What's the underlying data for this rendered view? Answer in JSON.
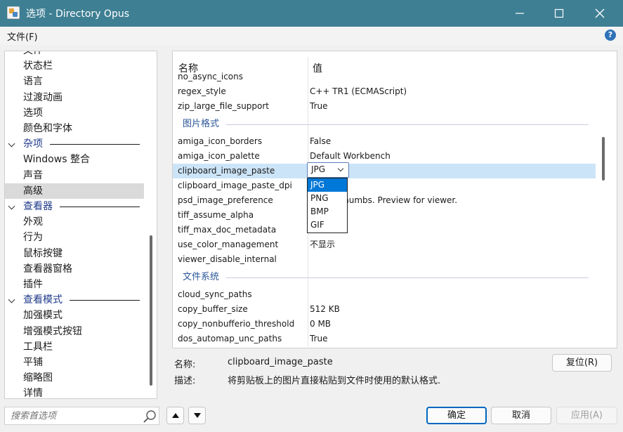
{
  "window": {
    "title": "选项 - Directory Opus"
  },
  "menu": {
    "file": "文件(F)",
    "help": "?"
  },
  "tree": {
    "items": [
      {
        "label": "文件",
        "group": false
      },
      {
        "label": "状态栏",
        "group": false
      },
      {
        "label": "语言",
        "group": false
      },
      {
        "label": "过渡动画",
        "group": false
      },
      {
        "label": "选项",
        "group": false
      },
      {
        "label": "颜色和字体",
        "group": false
      },
      {
        "label": "杂项",
        "group": true
      },
      {
        "label": "Windows 整合",
        "group": false
      },
      {
        "label": "声音",
        "group": false
      },
      {
        "label": "高级",
        "group": false,
        "selected": true
      },
      {
        "label": "查看器",
        "group": true
      },
      {
        "label": "外观",
        "group": false
      },
      {
        "label": "行为",
        "group": false
      },
      {
        "label": "鼠标按键",
        "group": false
      },
      {
        "label": "查看器窗格",
        "group": false
      },
      {
        "label": "插件",
        "group": false
      },
      {
        "label": "查看模式",
        "group": true
      },
      {
        "label": "加强模式",
        "group": false
      },
      {
        "label": "增强模式按钮",
        "group": false
      },
      {
        "label": "工具栏",
        "group": false
      },
      {
        "label": "平铺",
        "group": false
      },
      {
        "label": "缩略图",
        "group": false
      },
      {
        "label": "详情",
        "group": false
      }
    ]
  },
  "search": {
    "placeholder": "搜索首选项"
  },
  "grid": {
    "col_name": "名称",
    "col_value": "值",
    "rows": [
      {
        "type": "row",
        "name": "no_async_icons",
        "value": ""
      },
      {
        "type": "row",
        "name": "regex_style",
        "value": "C++ TR1 (ECMAScript)"
      },
      {
        "type": "row",
        "name": "zip_large_file_support",
        "value": "True"
      },
      {
        "type": "section",
        "label": "图片格式"
      },
      {
        "type": "row",
        "name": "amiga_icon_borders",
        "value": "False"
      },
      {
        "type": "row",
        "name": "amiga_icon_palette",
        "value": "Default Workbench"
      },
      {
        "type": "row",
        "name": "clipboard_image_paste",
        "value": "",
        "selected": true
      },
      {
        "type": "row",
        "name": "clipboard_image_paste_dpi",
        "value": ""
      },
      {
        "type": "row",
        "name": "psd_image_preference",
        "value": "mb for thumbs. Preview for viewer."
      },
      {
        "type": "row",
        "name": "tiff_assume_alpha",
        "value": ""
      },
      {
        "type": "row",
        "name": "tiff_max_doc_metadata",
        "value": ""
      },
      {
        "type": "row",
        "name": "use_color_management",
        "value": "不显示"
      },
      {
        "type": "row",
        "name": "viewer_disable_internal",
        "value": ""
      },
      {
        "type": "section",
        "label": "文件系统"
      },
      {
        "type": "row",
        "name": "cloud_sync_paths",
        "value": ""
      },
      {
        "type": "row",
        "name": "copy_buffer_size",
        "value": "512 KB"
      },
      {
        "type": "row",
        "name": "copy_nonbufferio_threshold",
        "value": "0 MB"
      },
      {
        "type": "row",
        "name": "dos_automap_unc_paths",
        "value": "True"
      }
    ],
    "combo": {
      "value": "JPG",
      "options": [
        "JPG",
        "PNG",
        "BMP",
        "GIF"
      ],
      "highlighted": "JPG"
    }
  },
  "details": {
    "name_label": "名称:",
    "name_value": "clipboard_image_paste",
    "desc_label": "描述:",
    "desc_value": "将剪贴板上的图片直接粘贴到文件时使用的默认格式."
  },
  "buttons": {
    "reset": "复位(R)",
    "ok": "确定",
    "cancel": "取消",
    "apply": "应用(A)"
  },
  "colors": {
    "titlebar": "#3e7f93",
    "accent": "#0078d7",
    "selection": "#cce4f7",
    "group_text": "#1e3a8a"
  }
}
